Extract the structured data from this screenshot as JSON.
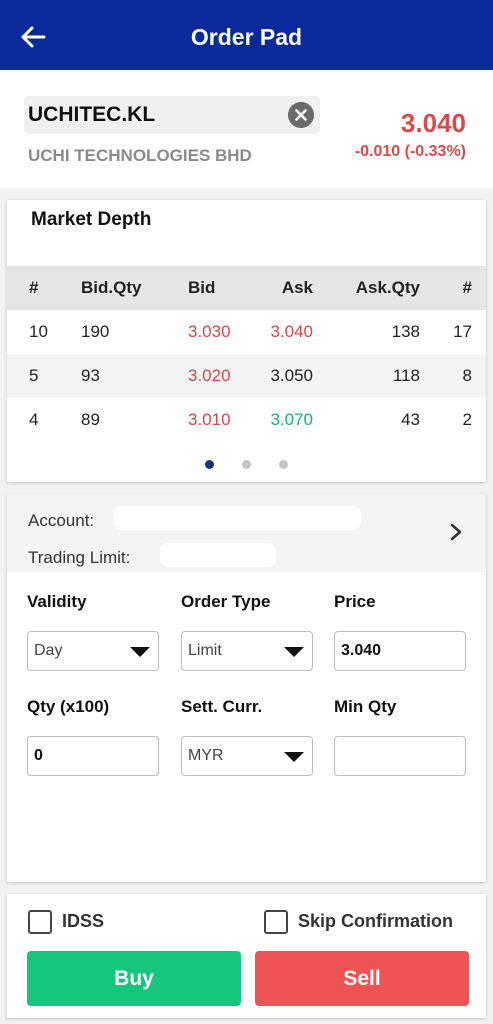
{
  "header": {
    "title": "Order Pad",
    "back_icon": "arrow-left-icon"
  },
  "stock": {
    "code": "UCHITEC.KL",
    "name": "UCHI TECHNOLOGIES BHD",
    "price": "3.040",
    "change": "-0.010 (-0.33%)",
    "price_color": "#e04848"
  },
  "market_depth": {
    "title": "Market Depth",
    "columns": [
      "#",
      "Bid.Qty",
      "Bid",
      "Ask",
      "Ask.Qty",
      "#"
    ],
    "rows": [
      {
        "bid_count": "10",
        "bid_qty": "190",
        "bid": "3.030",
        "ask": "3.040",
        "ask_qty": "138",
        "ask_count": "17"
      },
      {
        "bid_count": "5",
        "bid_qty": "93",
        "bid": "3.020",
        "ask": "3.050",
        "ask_qty": "118",
        "ask_count": "8"
      },
      {
        "bid_count": "4",
        "bid_qty": "89",
        "bid": "3.010",
        "ask": "3.070",
        "ask_qty": "43",
        "ask_count": "2"
      }
    ],
    "page_indicator": {
      "pages": 3,
      "active": 1
    }
  },
  "order_form": {
    "account_label": "Account:",
    "trading_limit_label": "Trading Limit:",
    "validity": {
      "label": "Validity",
      "value": "Day"
    },
    "order_type": {
      "label": "Order Type",
      "value": "Limit"
    },
    "price": {
      "label": "Price",
      "value": "3.040"
    },
    "qty": {
      "label": "Qty (x100)",
      "value": "0"
    },
    "sett_curr": {
      "label": "Sett. Curr.",
      "value": "MYR"
    },
    "min_qty": {
      "label": "Min Qty",
      "value": ""
    }
  },
  "actions": {
    "idss_label": "IDSS",
    "skip_confirmation_label": "Skip Confirmation",
    "buy_label": "Buy",
    "sell_label": "Sell",
    "buy_color": "#14c77c",
    "sell_color": "#f05355"
  },
  "colors": {
    "brand": "#0a2a9c",
    "bid": "#d9454a",
    "ask_up": "#1ab07a"
  }
}
